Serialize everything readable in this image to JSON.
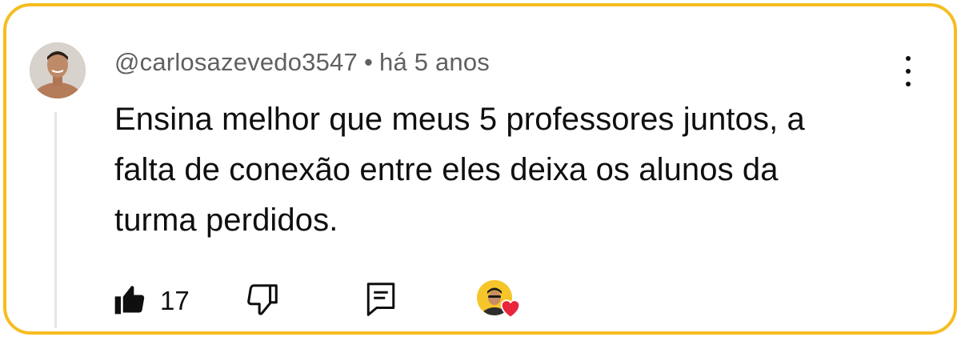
{
  "comment": {
    "author": "@carlosazevedo3547",
    "separator": "•",
    "time": "há 5 anos",
    "text_lines": [
      "Ensina melhor que meus 5 professores juntos, a",
      "falta de conexão entre eles deixa os alunos da",
      "turma perdidos."
    ]
  },
  "actions": {
    "like_icon": "thumbs-up-filled-icon",
    "like_count": "17",
    "dislike_icon": "thumbs-down-outline-icon",
    "reply_icon": "reply-comment-icon",
    "creator_heart_icon": "creator-heart-icon"
  },
  "menu": {
    "icon": "more-vertical-icon"
  },
  "colors": {
    "border_accent": "#f5bd1f",
    "meta_text": "#606060",
    "heart": "#e8263c",
    "creator_avatar_bg": "#f6c52a"
  }
}
